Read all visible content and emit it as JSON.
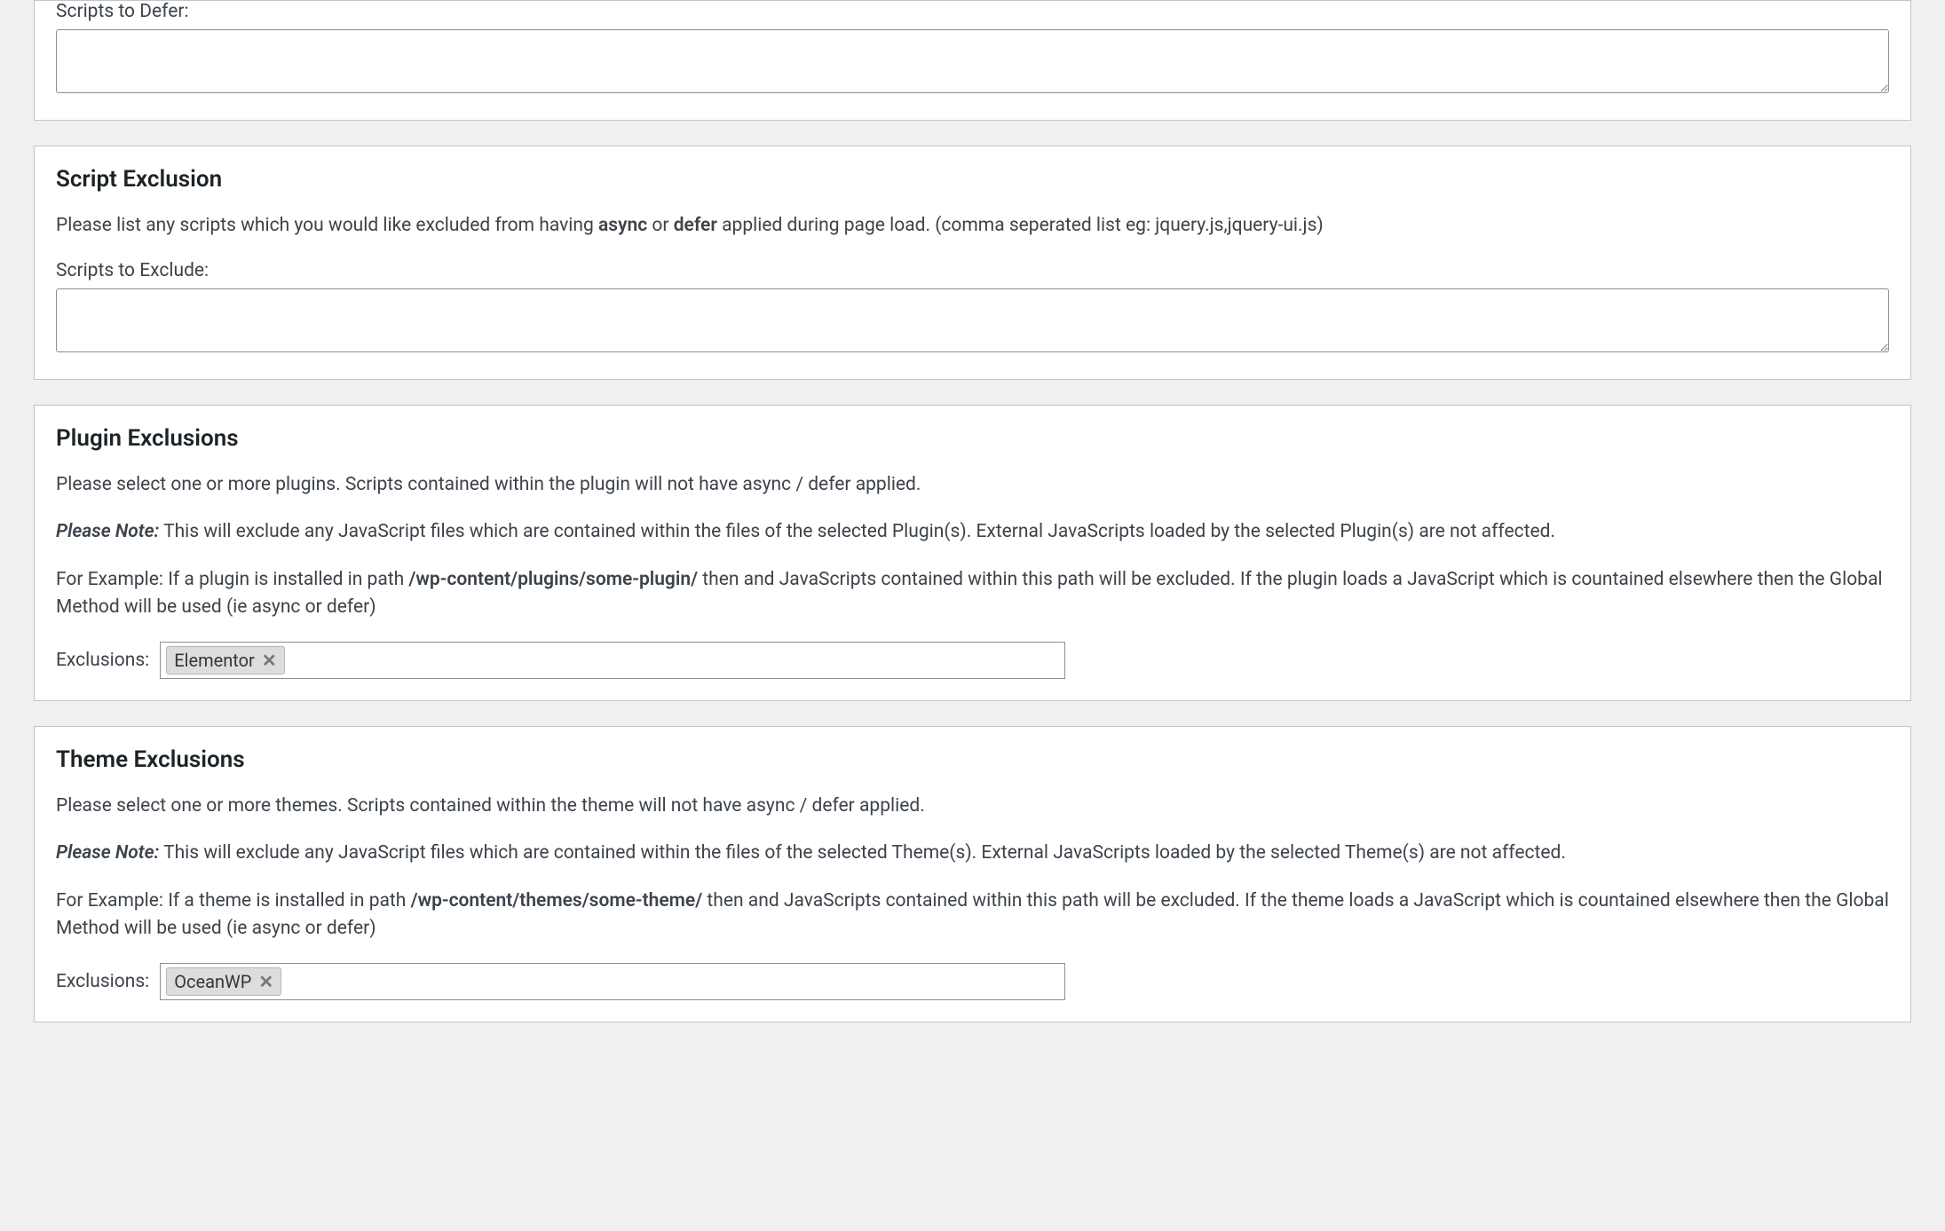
{
  "panels": {
    "defer": {
      "textarea_label": "Scripts to Defer:"
    },
    "script_exclusion": {
      "heading": "Script Exclusion",
      "desc_pre": "Please list any scripts which you would like excluded from having ",
      "desc_bold1": "async",
      "desc_mid": " or ",
      "desc_bold2": "defer",
      "desc_post": " applied during page load. (comma seperated list eg: jquery.js,jquery-ui.js)",
      "textarea_label": "Scripts to Exclude:"
    },
    "plugin_exclusions": {
      "heading": "Plugin Exclusions",
      "p1": "Please select one or more plugins. Scripts contained within the plugin will not have async / defer applied.",
      "note_label": "Please Note:",
      "note_text": " This will exclude any JavaScript files which are contained within the files of the selected Plugin(s). External JavaScripts loaded by the selected Plugin(s) are not affected.",
      "ex_pre": "For Example: If a plugin is installed in path ",
      "ex_bold": "/wp-content/plugins/some-plugin/",
      "ex_post": " then and JavaScripts contained within this path will be excluded. If the plugin loads a JavaScript which is countained elsewhere then the Global Method will be used (ie async or defer)",
      "token_label": "Exclusions:",
      "tokens": [
        "Elementor"
      ]
    },
    "theme_exclusions": {
      "heading": "Theme Exclusions",
      "p1": "Please select one or more themes. Scripts contained within the theme will not have async / defer applied.",
      "note_label": "Please Note:",
      "note_text": " This will exclude any JavaScript files which are contained within the files of the selected Theme(s). External JavaScripts loaded by the selected Theme(s) are not affected.",
      "ex_pre": "For Example: If a theme is installed in path ",
      "ex_bold": "/wp-content/themes/some-theme/",
      "ex_post": " then and JavaScripts contained within this path will be excluded. If the theme loads a JavaScript which is countained elsewhere then the Global Method will be used (ie async or defer)",
      "token_label": "Exclusions:",
      "tokens": [
        "OceanWP"
      ]
    }
  }
}
